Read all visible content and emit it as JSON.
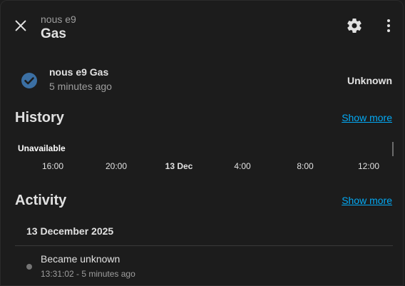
{
  "header": {
    "subtitle": "nous e9",
    "title": "Gas",
    "close_icon": "close-icon",
    "settings_icon": "gear-icon",
    "more_icon": "more-vertical-icon"
  },
  "entity": {
    "icon": "check-circle-icon",
    "name": "nous e9 Gas",
    "last_changed": "5 minutes ago",
    "state": "Unknown"
  },
  "history": {
    "title": "History",
    "show_more": "Show more",
    "bar_label": "Unavailable",
    "ticks": [
      "16:00",
      "20:00",
      "13 Dec",
      "4:00",
      "8:00",
      "12:00"
    ]
  },
  "activity": {
    "title": "Activity",
    "show_more": "Show more",
    "date": "13 December 2025",
    "entries": [
      {
        "title": "Became unknown",
        "time": "13:31:02 - 5 minutes ago"
      }
    ]
  },
  "colors": {
    "accent": "#03a9f4",
    "state_icon": "#3b6fa3",
    "background": "#1c1c1c"
  }
}
